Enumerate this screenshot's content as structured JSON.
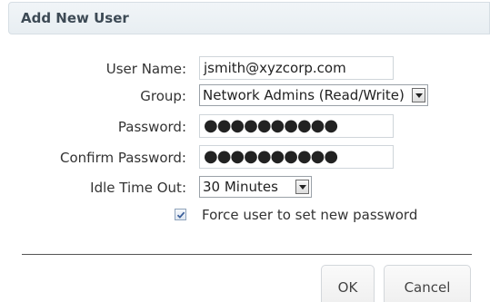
{
  "dialog": {
    "title": "Add New User"
  },
  "form": {
    "user_name": {
      "label": "User Name:",
      "value": "jsmith@xyzcorp.com"
    },
    "group": {
      "label": "Group:",
      "selected": "Network Admins (Read/Write)"
    },
    "password": {
      "label": "Password:",
      "masked_value": "●●●●●●●●●●"
    },
    "confirm_password": {
      "label": "Confirm Password:",
      "masked_value": "●●●●●●●●●●"
    },
    "idle_time_out": {
      "label": "Idle Time Out:",
      "selected": "30 Minutes"
    },
    "force_new_password": {
      "label": "Force user to set new password",
      "checked": true
    }
  },
  "buttons": {
    "ok_label": "OK",
    "cancel_label": "Cancel"
  },
  "icons": {
    "dropdown": "chevron-down-icon",
    "checkbox": "checkmark-icon"
  },
  "colors": {
    "header_bg": "#e8eef2",
    "check_color": "#3b5f9a"
  }
}
